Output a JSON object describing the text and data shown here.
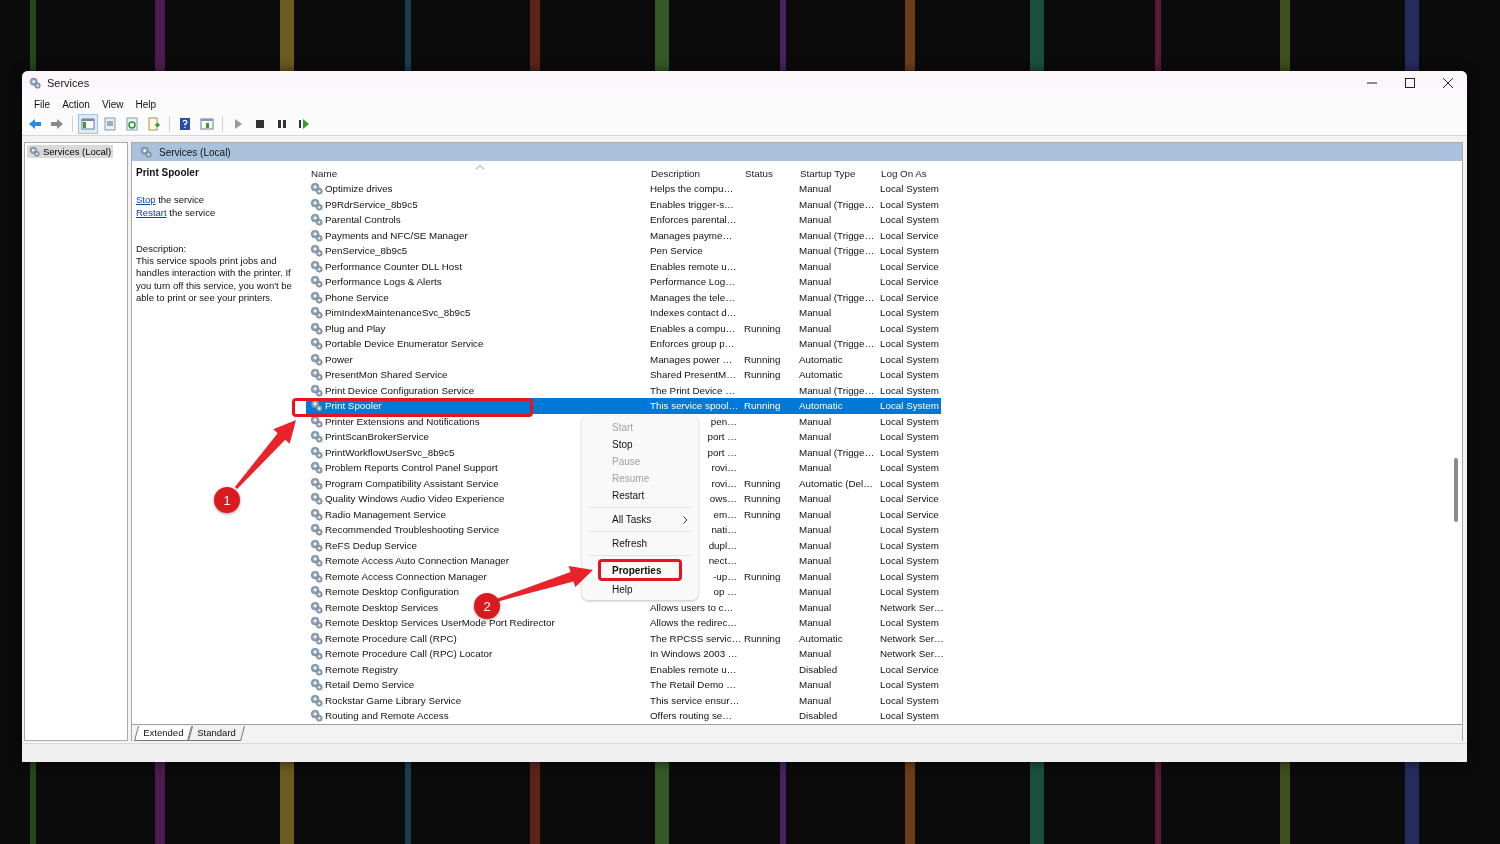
{
  "window": {
    "title": "Services"
  },
  "menu_bar": [
    "File",
    "Action",
    "View",
    "Help"
  ],
  "tree": {
    "items": [
      {
        "label": "Services (Local)",
        "selected": true
      }
    ]
  },
  "pane_header": "Services (Local)",
  "details": {
    "title": "Print Spooler",
    "actions": [
      {
        "link": "Stop",
        "text": " the service"
      },
      {
        "link": "Restart",
        "text": " the service"
      }
    ],
    "description_label": "Description:",
    "description": "This service spools print jobs and handles interaction with the printer. If you turn off this service, you won't be able to print or see your printers."
  },
  "table": {
    "columns": [
      {
        "label": "Name",
        "sorted": true
      },
      {
        "label": "Description",
        "sorted": false
      },
      {
        "label": "Status",
        "sorted": false
      },
      {
        "label": "Startup Type",
        "sorted": false
      },
      {
        "label": "Log On As",
        "sorted": false
      }
    ],
    "rows": [
      {
        "name": "Optimize drives",
        "description": "Helps the compu…",
        "startup_type": "Manual",
        "log_on_as": "Local System",
        "selected": false
      },
      {
        "name": "P9RdrService_8b9c5",
        "description": "Enables trigger-s…",
        "startup_type": "Manual (Trigge…",
        "log_on_as": "Local System",
        "selected": false
      },
      {
        "name": "Parental Controls",
        "description": "Enforces parental…",
        "startup_type": "Manual",
        "log_on_as": "Local System",
        "selected": false
      },
      {
        "name": "Payments and NFC/SE Manager",
        "description": "Manages payme…",
        "startup_type": "Manual (Trigge…",
        "log_on_as": "Local Service",
        "selected": false
      },
      {
        "name": "PenService_8b9c5",
        "description": "Pen Service",
        "startup_type": "Manual (Trigge…",
        "log_on_as": "Local System",
        "selected": false
      },
      {
        "name": "Performance Counter DLL Host",
        "description": "Enables remote u…",
        "startup_type": "Manual",
        "log_on_as": "Local Service",
        "selected": false
      },
      {
        "name": "Performance Logs & Alerts",
        "description": "Performance Log…",
        "startup_type": "Manual",
        "log_on_as": "Local Service",
        "selected": false
      },
      {
        "name": "Phone Service",
        "description": "Manages the tele…",
        "startup_type": "Manual (Trigge…",
        "log_on_as": "Local Service",
        "selected": false
      },
      {
        "name": "PimIndexMaintenanceSvc_8b9c5",
        "description": "Indexes contact d…",
        "startup_type": "Manual",
        "log_on_as": "Local System",
        "selected": false
      },
      {
        "name": "Plug and Play",
        "description": "Enables a compu…",
        "status": "Running",
        "startup_type": "Manual",
        "log_on_as": "Local System",
        "selected": false
      },
      {
        "name": "Portable Device Enumerator Service",
        "description": "Enforces group p…",
        "startup_type": "Manual (Trigge…",
        "log_on_as": "Local System",
        "selected": false
      },
      {
        "name": "Power",
        "description": "Manages power …",
        "status": "Running",
        "startup_type": "Automatic",
        "log_on_as": "Local System",
        "selected": false
      },
      {
        "name": "PresentMon Shared Service",
        "description": "Shared PresentM…",
        "status": "Running",
        "startup_type": "Automatic",
        "log_on_as": "Local System",
        "selected": false
      },
      {
        "name": "Print Device Configuration Service",
        "description": "The Print Device …",
        "startup_type": "Manual (Trigge…",
        "log_on_as": "Local System",
        "selected": false
      },
      {
        "name": "Print Spooler",
        "description": "This service spool…",
        "status": "Running",
        "startup_type": "Automatic",
        "log_on_as": "Local System",
        "selected": true
      },
      {
        "name": "Printer Extensions and Notifications",
        "description": "pen…",
        "description_cut": true,
        "startup_type": "Manual",
        "log_on_as": "Local System",
        "selected": false
      },
      {
        "name": "PrintScanBrokerService",
        "description": "port …",
        "description_cut": true,
        "startup_type": "Manual",
        "log_on_as": "Local System",
        "selected": false
      },
      {
        "name": "PrintWorkflowUserSvc_8b9c5",
        "description": "port …",
        "description_cut": true,
        "startup_type": "Manual (Trigge…",
        "log_on_as": "Local System",
        "selected": false
      },
      {
        "name": "Problem Reports Control Panel Support",
        "description": "rovi…",
        "description_cut": true,
        "startup_type": "Manual",
        "log_on_as": "Local System",
        "selected": false
      },
      {
        "name": "Program Compatibility Assistant Service",
        "description": "rovi…",
        "description_cut": true,
        "status": "Running",
        "startup_type": "Automatic (Del…",
        "log_on_as": "Local System",
        "selected": false
      },
      {
        "name": "Quality Windows Audio Video Experience",
        "description": "ows…",
        "description_cut": true,
        "status": "Running",
        "startup_type": "Manual",
        "log_on_as": "Local Service",
        "selected": false
      },
      {
        "name": "Radio Management Service",
        "description": "em…",
        "description_cut": true,
        "status": "Running",
        "startup_type": "Manual",
        "log_on_as": "Local Service",
        "selected": false
      },
      {
        "name": "Recommended Troubleshooting Service",
        "description": "nati…",
        "description_cut": true,
        "startup_type": "Manual",
        "log_on_as": "Local System",
        "selected": false
      },
      {
        "name": "ReFS Dedup Service",
        "description": "dupl…",
        "description_cut": true,
        "startup_type": "Manual",
        "log_on_as": "Local System",
        "selected": false
      },
      {
        "name": "Remote Access Auto Connection Manager",
        "description": "nect…",
        "description_cut": true,
        "startup_type": "Manual",
        "log_on_as": "Local System",
        "selected": false
      },
      {
        "name": "Remote Access Connection Manager",
        "description": "-up…",
        "description_cut": true,
        "status": "Running",
        "startup_type": "Manual",
        "log_on_as": "Local System",
        "selected": false
      },
      {
        "name": "Remote Desktop Configuration",
        "description": "op …",
        "description_cut": true,
        "startup_type": "Manual",
        "log_on_as": "Local System",
        "selected": false
      },
      {
        "name": "Remote Desktop Services",
        "description": "Allows users to c…",
        "startup_type": "Manual",
        "log_on_as": "Network Ser…",
        "selected": false
      },
      {
        "name": "Remote Desktop Services UserMode Port Redirector",
        "description": "Allows the redirec…",
        "startup_type": "Manual",
        "log_on_as": "Local System",
        "selected": false
      },
      {
        "name": "Remote Procedure Call (RPC)",
        "description": "The RPCSS servic…",
        "status": "Running",
        "startup_type": "Automatic",
        "log_on_as": "Network Ser…",
        "selected": false
      },
      {
        "name": "Remote Procedure Call (RPC) Locator",
        "description": "In Windows 2003 …",
        "startup_type": "Manual",
        "log_on_as": "Network Ser…",
        "selected": false
      },
      {
        "name": "Remote Registry",
        "description": "Enables remote u…",
        "startup_type": "Disabled",
        "log_on_as": "Local Service",
        "selected": false
      },
      {
        "name": "Retail Demo Service",
        "description": "The Retail Demo …",
        "startup_type": "Manual",
        "log_on_as": "Local System",
        "selected": false
      },
      {
        "name": "Rockstar Game Library Service",
        "description": "This service ensur…",
        "startup_type": "Manual",
        "log_on_as": "Local System",
        "selected": false
      },
      {
        "name": "Routing and Remote Access",
        "description": "Offers routing se…",
        "startup_type": "Disabled",
        "log_on_as": "Local System",
        "selected": false
      }
    ]
  },
  "context_menu": [
    {
      "label": "Start",
      "disabled": true
    },
    {
      "label": "Stop",
      "disabled": false
    },
    {
      "label": "Pause",
      "disabled": true
    },
    {
      "label": "Resume",
      "disabled": true
    },
    {
      "label": "Restart",
      "disabled": false
    },
    {
      "label": "All Tasks",
      "disabled": false,
      "separator_before": true,
      "submenu": true
    },
    {
      "label": "Refresh",
      "disabled": false,
      "separator_before": true
    },
    {
      "label": "Properties",
      "disabled": false,
      "separator_before": true,
      "default": true,
      "highlighted": true
    },
    {
      "label": "Help",
      "disabled": false
    }
  ],
  "tabs": [
    {
      "label": "Extended",
      "selected": true
    },
    {
      "label": "Standard",
      "selected": false
    }
  ],
  "annotations": [
    {
      "label": "1"
    },
    {
      "label": "2"
    }
  ]
}
